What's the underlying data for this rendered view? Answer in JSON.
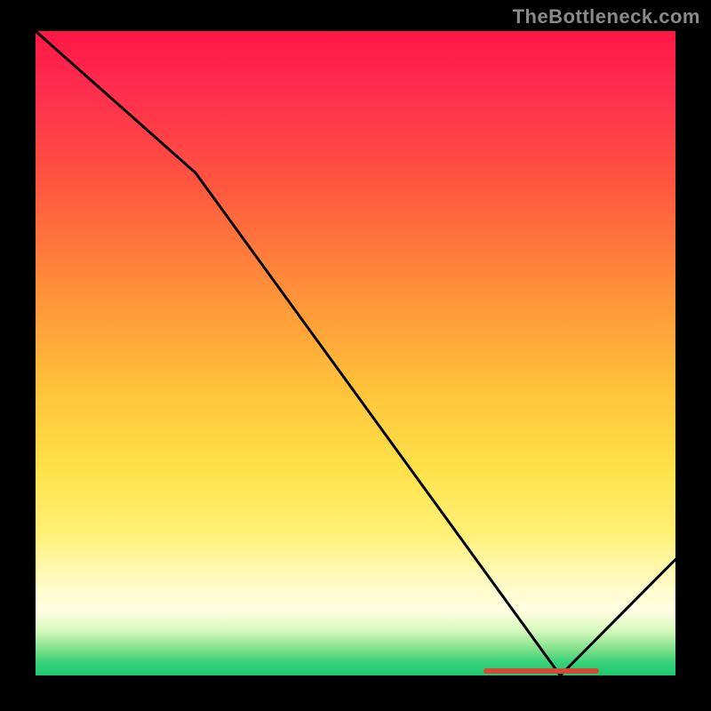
{
  "watermark": "TheBottleneck.com",
  "chart_data": {
    "type": "line",
    "title": "",
    "xlabel": "",
    "ylabel": "",
    "xlim": [
      0,
      100
    ],
    "ylim": [
      0,
      100
    ],
    "x": [
      0,
      25,
      82,
      100
    ],
    "values": [
      100,
      78,
      0,
      18
    ],
    "gradient_stops": [
      {
        "pct": 0,
        "color": "#ff1744"
      },
      {
        "pct": 22,
        "color": "#ff5040"
      },
      {
        "pct": 40,
        "color": "#ff8f3a"
      },
      {
        "pct": 68,
        "color": "#ffe24a"
      },
      {
        "pct": 90,
        "color": "#fffde0"
      },
      {
        "pct": 100,
        "color": "#1fc96f"
      }
    ],
    "marker": {
      "x_start": 70,
      "x_end": 88,
      "y": 0,
      "color": "#d44a36"
    }
  }
}
